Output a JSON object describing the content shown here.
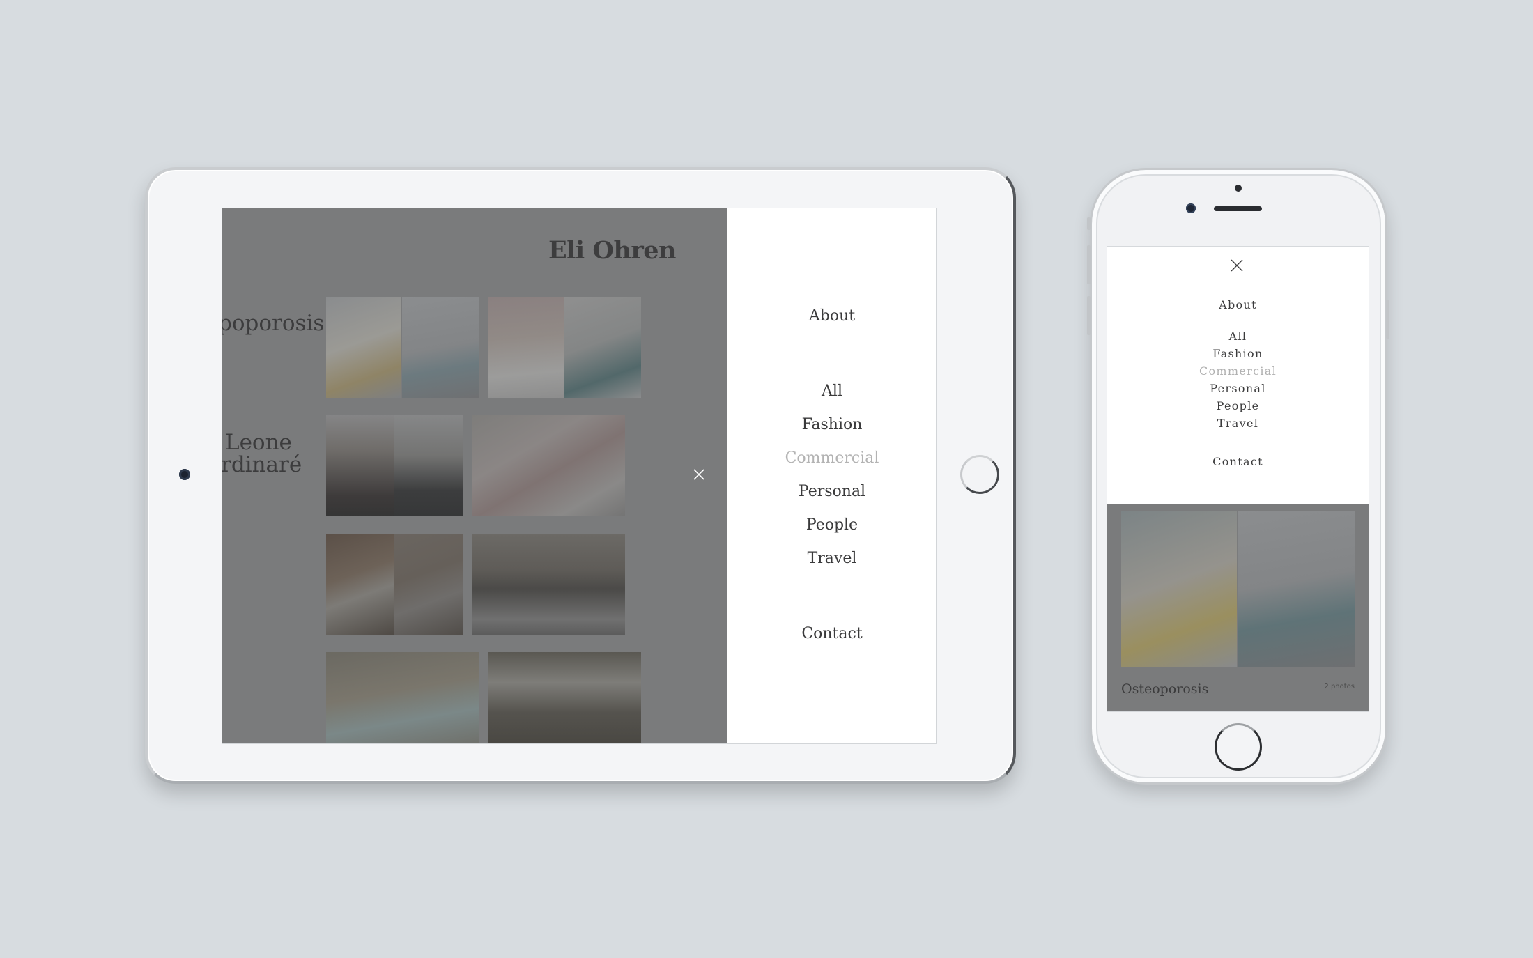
{
  "site": {
    "title": "Eli Ohren"
  },
  "tablet": {
    "projects": [
      {
        "title": "poporosis"
      },
      {
        "title_line1": "Leone",
        "title_line2": "rdinaré"
      }
    ]
  },
  "menu": {
    "about": "About",
    "categories": [
      {
        "label": "All",
        "active": false
      },
      {
        "label": "Fashion",
        "active": false
      },
      {
        "label": "Commercial",
        "active": true
      },
      {
        "label": "Personal",
        "active": false
      },
      {
        "label": "People",
        "active": false
      },
      {
        "label": "Travel",
        "active": false
      }
    ],
    "contact": "Contact",
    "close_icon": "close-icon"
  },
  "phone": {
    "project_title": "Osteoporosis",
    "photo_count": "2 photos"
  },
  "colors": {
    "background": "#d7dce0",
    "gallery_overlay": "#7a7b7c",
    "menu_text": "#3a3a3b",
    "menu_active": "#b3b3b3"
  }
}
